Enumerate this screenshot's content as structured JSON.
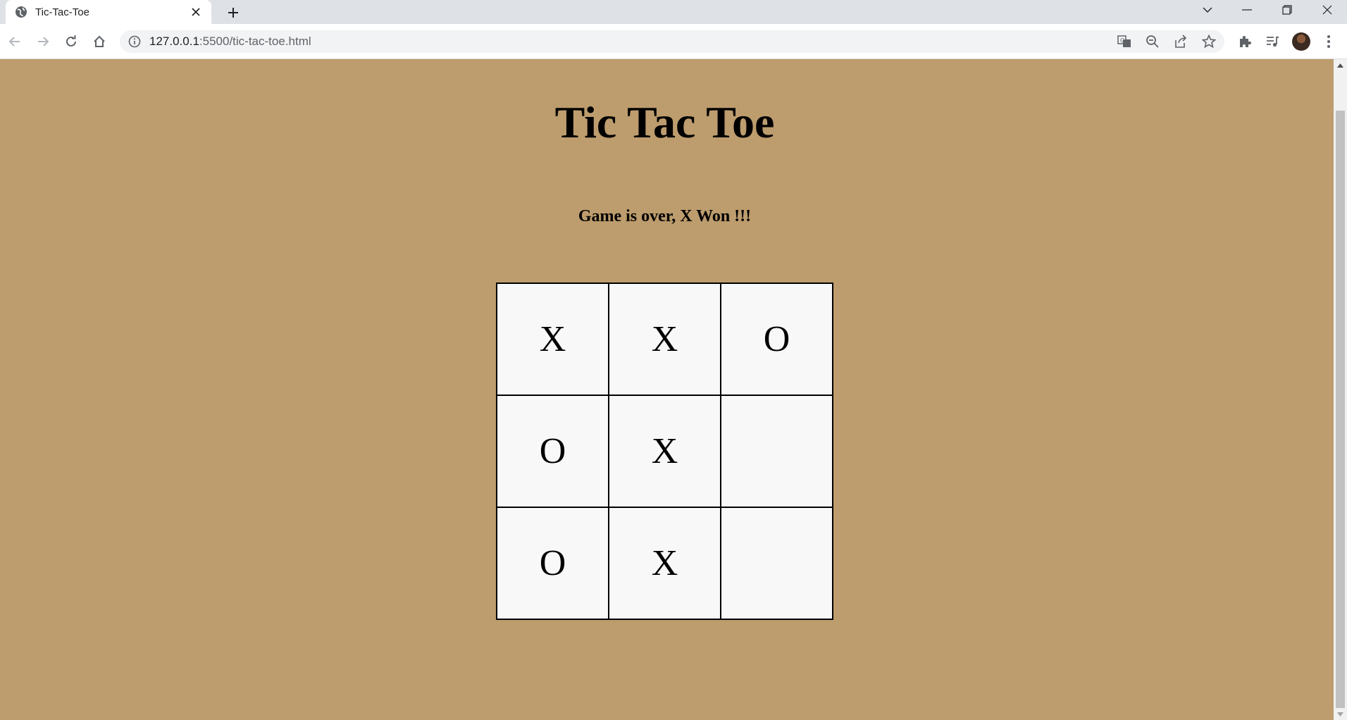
{
  "browser": {
    "tab_title": "Tic-Tac-Toe",
    "url_host": "127.0.0.1",
    "url_rest": ":5500/tic-tac-toe.html"
  },
  "page": {
    "title": "Tic Tac Toe",
    "status": "Game is over, X Won !!!",
    "background_color": "#bd9c6d",
    "cell_color": "#f8f8f8"
  },
  "board": {
    "cells": [
      "X",
      "X",
      "O",
      "O",
      "X",
      "",
      "O",
      "X",
      ""
    ]
  }
}
